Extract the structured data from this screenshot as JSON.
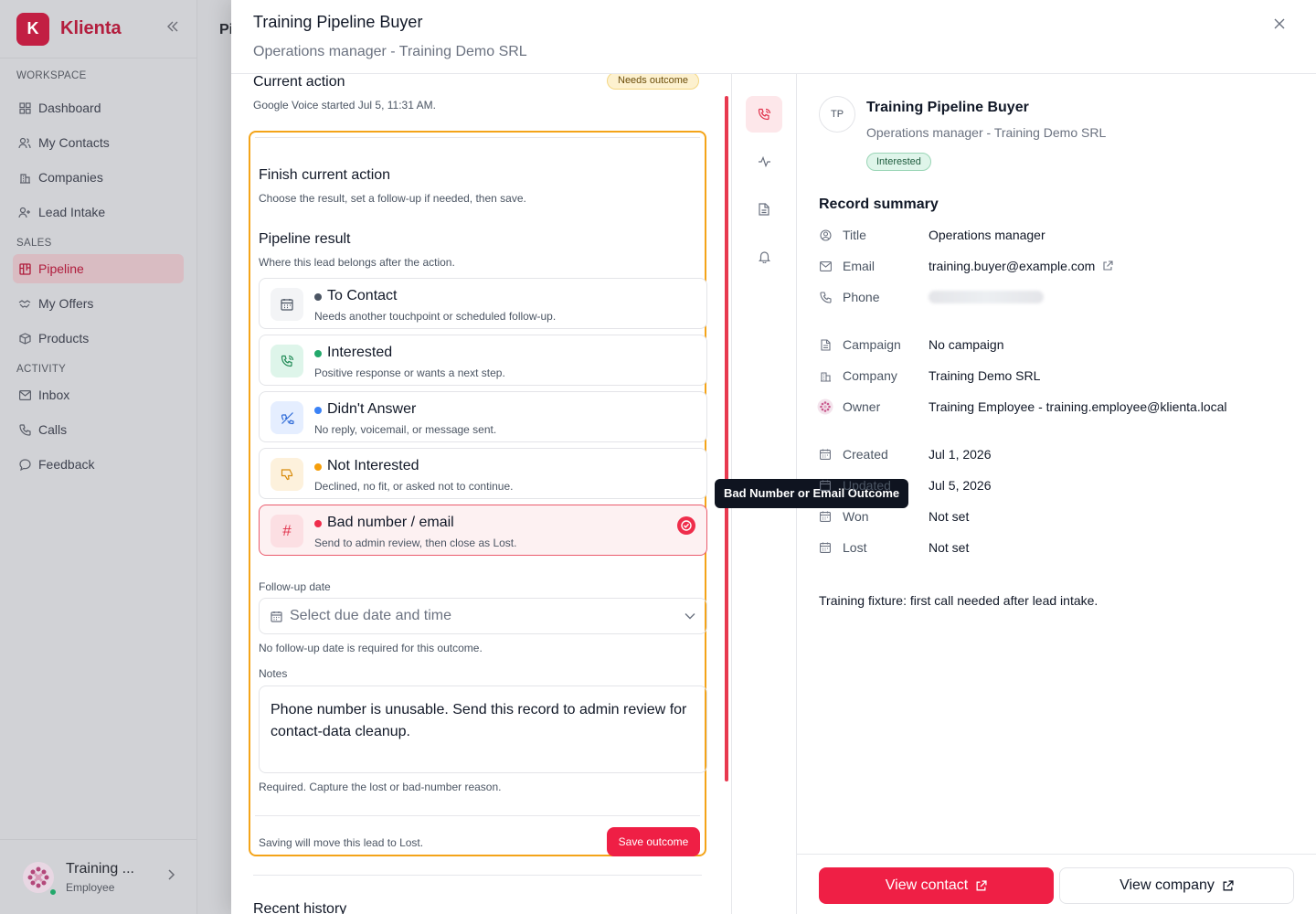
{
  "app": {
    "name": "Klienta",
    "logo_letter": "K",
    "brand_color": "#c21f43"
  },
  "sidebar": {
    "sections": [
      {
        "label": "WORKSPACE"
      },
      {
        "label": "SALES"
      },
      {
        "label": "ACTIVITY"
      }
    ],
    "items": [
      {
        "label": "Dashboard",
        "icon": "grid-icon"
      },
      {
        "label": "My Contacts",
        "icon": "users-icon"
      },
      {
        "label": "Companies",
        "icon": "building-icon"
      },
      {
        "label": "Lead Intake",
        "icon": "user-plus-icon"
      },
      {
        "label": "Pipeline",
        "icon": "kanban-icon",
        "active": true
      },
      {
        "label": "My Offers",
        "icon": "handshake-icon"
      },
      {
        "label": "Products",
        "icon": "box-icon"
      },
      {
        "label": "Inbox",
        "icon": "mail-icon"
      },
      {
        "label": "Calls",
        "icon": "phone-icon"
      },
      {
        "label": "Feedback",
        "icon": "message-icon"
      }
    ],
    "user": {
      "name": "Training ...",
      "role": "Employee"
    }
  },
  "background": {
    "page_title_fragment": "Pi"
  },
  "drawer": {
    "title": "Training Pipeline Buyer",
    "subtitle": "Operations manager - Training Demo SRL",
    "current_action": {
      "heading": "Current action",
      "badge": "Needs outcome",
      "started": "Google Voice started Jul 5, 11:31 AM."
    },
    "finish": {
      "title": "Finish current action",
      "subtitle": "Choose the result, set a follow-up if needed, then save."
    },
    "pipeline_result": {
      "title": "Pipeline result",
      "subtitle": "Where this lead belongs after the action.",
      "options": [
        {
          "label": "To Contact",
          "desc": "Needs another touchpoint or scheduled follow-up.",
          "dot": "#4b5563",
          "icon": "calendar-icon"
        },
        {
          "label": "Interested",
          "desc": "Positive response or wants a next step.",
          "dot": "#22a86b",
          "icon": "phone-call-icon"
        },
        {
          "label": "Didn't Answer",
          "desc": "No reply, voicemail, or message sent.",
          "dot": "#3b82f6",
          "icon": "phone-off-icon"
        },
        {
          "label": "Not Interested",
          "desc": "Declined, no fit, or asked not to continue.",
          "dot": "#f59e0b",
          "icon": "thumbs-down-icon"
        },
        {
          "label": "Bad number / email",
          "desc": "Send to admin review, then close as Lost.",
          "dot": "#ef2d4b",
          "icon": "hash-icon",
          "selected": true
        }
      ]
    },
    "follow_up": {
      "label": "Follow-up date",
      "placeholder": "Select due date and time",
      "hint": "No follow-up date is required for this outcome."
    },
    "notes": {
      "label": "Notes",
      "value": "Phone number is unusable. Send this record to admin review for contact-data cleanup.",
      "hint": "Required. Capture the lost or bad-number reason."
    },
    "footer": {
      "message": "Saving will move this lead to Lost.",
      "save_label": "Save outcome"
    },
    "recent_history": "Recent history",
    "tooltip": "Bad Number or Email Outcome",
    "tabs": [
      {
        "icon": "phone-call-icon",
        "active": true
      },
      {
        "icon": "activity-icon"
      },
      {
        "icon": "file-icon"
      },
      {
        "icon": "bell-icon"
      }
    ],
    "record": {
      "initials": "TP",
      "name": "Training Pipeline Buyer",
      "subtitle": "Operations manager - Training Demo SRL",
      "status": "Interested",
      "summary_title": "Record summary",
      "fields": [
        {
          "label": "Title",
          "value": "Operations manager",
          "icon": "user-circle-icon"
        },
        {
          "label": "Email",
          "value": "training.buyer@example.com",
          "icon": "mail-icon"
        },
        {
          "label": "Phone",
          "value": "",
          "icon": "phone-icon",
          "blurred": true
        },
        {
          "label": "Campaign",
          "value": "No campaign",
          "icon": "file-icon"
        },
        {
          "label": "Company",
          "value": "Training Demo SRL",
          "icon": "building-icon"
        },
        {
          "label": "Owner",
          "value": "Training Employee - training.employee@klienta.local",
          "icon": "avatar-pattern-icon"
        },
        {
          "label": "Created",
          "value": "Jul 1, 2026",
          "icon": "calendar-icon"
        },
        {
          "label": "Updated",
          "value": "Jul 5, 2026",
          "icon": "calendar-icon"
        },
        {
          "label": "Won",
          "value": "Not set",
          "icon": "calendar-icon"
        },
        {
          "label": "Lost",
          "value": "Not set",
          "icon": "calendar-icon"
        }
      ],
      "fixture_note": "Training fixture: first call needed after lead intake.",
      "view_contact_label": "View contact",
      "view_company_label": "View company"
    }
  }
}
